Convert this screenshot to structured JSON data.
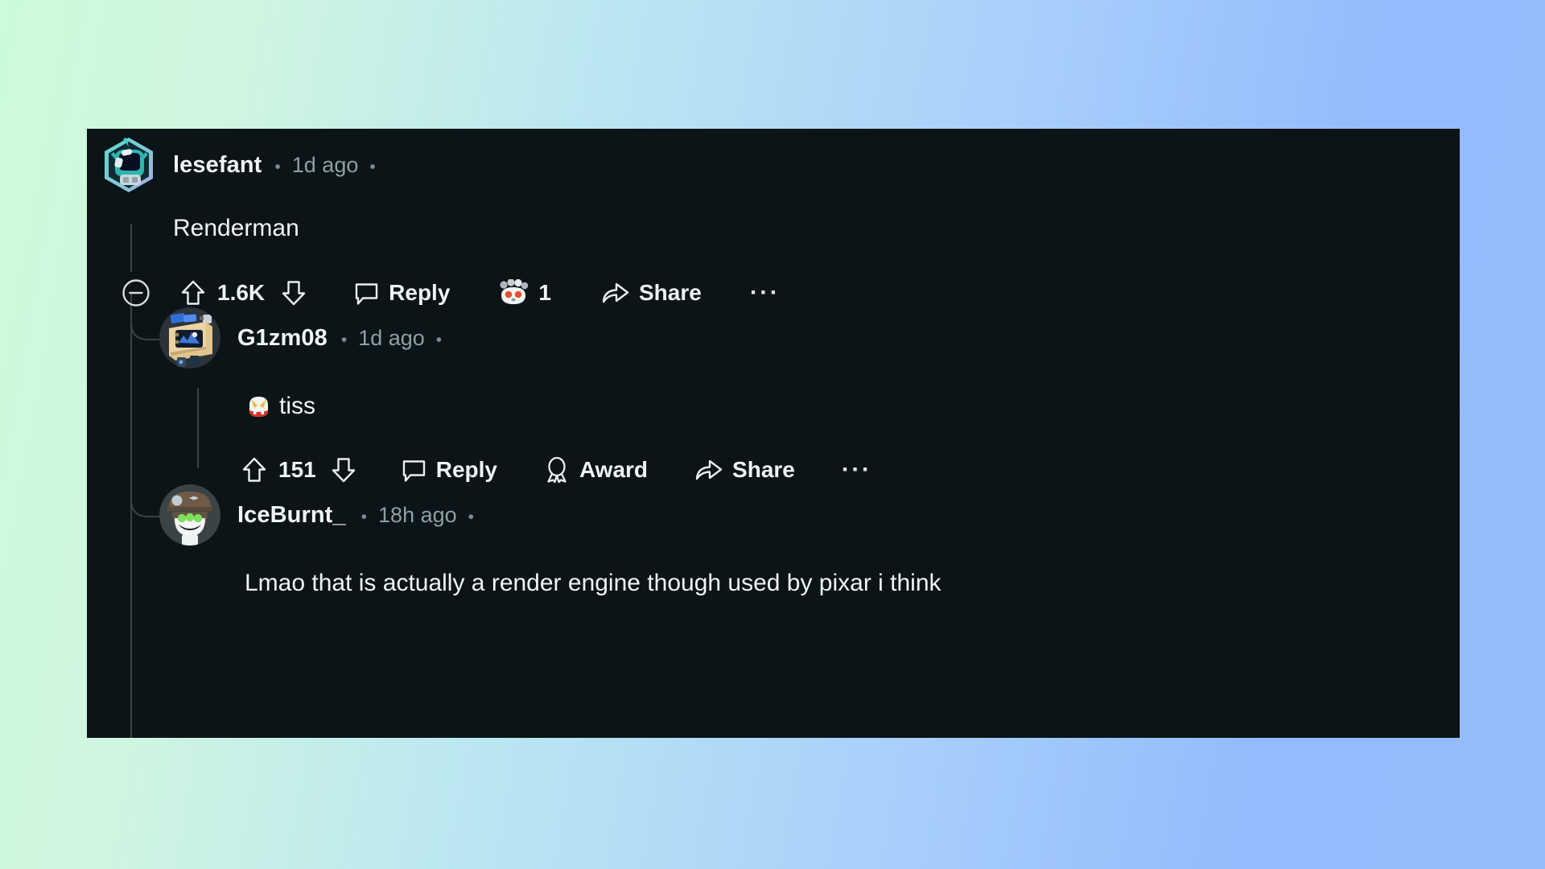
{
  "background": {
    "gradient_from": "#CCFBD9",
    "gradient_to": "#95BCFD"
  },
  "panel": {
    "background": "#0B1416",
    "thread_line_color": "#3A4245"
  },
  "comments": [
    {
      "id": "comment-1",
      "author": "lesefant",
      "separator": "•",
      "timestamp": "1d ago",
      "trailing_separator": "•",
      "body": "Renderman",
      "avatar": {
        "name": "avatar-lesefant",
        "description": "teal-astronaut-hexagon-avatar"
      },
      "actions": {
        "collapse_icon": "collapse-minus-icon",
        "upvote_icon": "upvote-arrow-icon",
        "score": "1.6K",
        "downvote_icon": "downvote-arrow-icon",
        "reply_icon": "comment-bubble-icon",
        "reply_label": "Reply",
        "award_icon": "snoo-award-icon",
        "award_count": "1",
        "share_icon": "share-arrow-icon",
        "share_label": "Share",
        "more_label": "···"
      }
    },
    {
      "id": "comment-2",
      "author": "G1zm08",
      "separator": "•",
      "timestamp": "1d ago",
      "trailing_separator": "•",
      "body": "tiss",
      "body_emoji": "oni-devil-mask-emoji",
      "avatar": {
        "name": "avatar-g1zm08",
        "description": "retro-computer-monitor-avatar"
      },
      "actions": {
        "upvote_icon": "upvote-arrow-icon",
        "score": "151",
        "downvote_icon": "downvote-arrow-icon",
        "reply_icon": "comment-bubble-icon",
        "reply_label": "Reply",
        "award_icon": "award-rosette-icon",
        "award_label": "Award",
        "share_icon": "share-arrow-icon",
        "share_label": "Share",
        "more_label": "···"
      }
    },
    {
      "id": "comment-3",
      "author": "IceBurnt_",
      "separator": "•",
      "timestamp": "18h ago",
      "trailing_separator": "•",
      "body": "Lmao that is actually a render engine though used by pixar i think",
      "avatar": {
        "name": "avatar-iceburnt",
        "description": "snoo-with-brown-cap-green-eyes-avatar"
      }
    }
  ]
}
